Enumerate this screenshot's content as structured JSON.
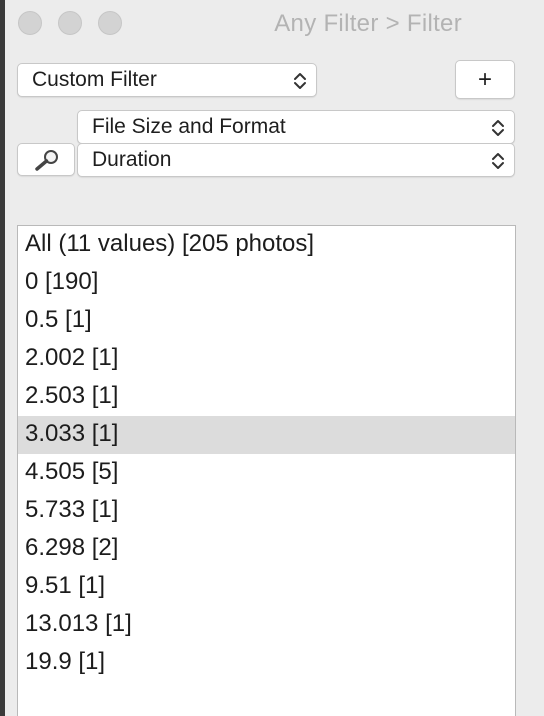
{
  "window": {
    "title": "Any Filter > Filter",
    "traffic_lights": [
      "close",
      "minimize",
      "zoom"
    ]
  },
  "toolbar": {
    "preset_select_value": "Custom Filter",
    "add_button_label": "+",
    "search_icon": "magnifier-icon"
  },
  "criteria": {
    "category_select_value": "File Size and Format",
    "field_select_value": "Duration"
  },
  "values_list": {
    "items": [
      "All (11 values) [205 photos]",
      "0 [190]",
      "0.5 [1]",
      "2.002 [1]",
      "2.503 [1]",
      "3.033 [1]",
      "4.505 [5]",
      "5.733 [1]",
      "6.298 [2]",
      "9.51 [1]",
      "13.013 [1]",
      "19.9 [1]"
    ],
    "selected_item": "3.033 [1]"
  },
  "colors": {
    "window_bg": "#ececec",
    "selected_row_bg": "#dcdcdc",
    "title_text": "#b3b3b3"
  }
}
